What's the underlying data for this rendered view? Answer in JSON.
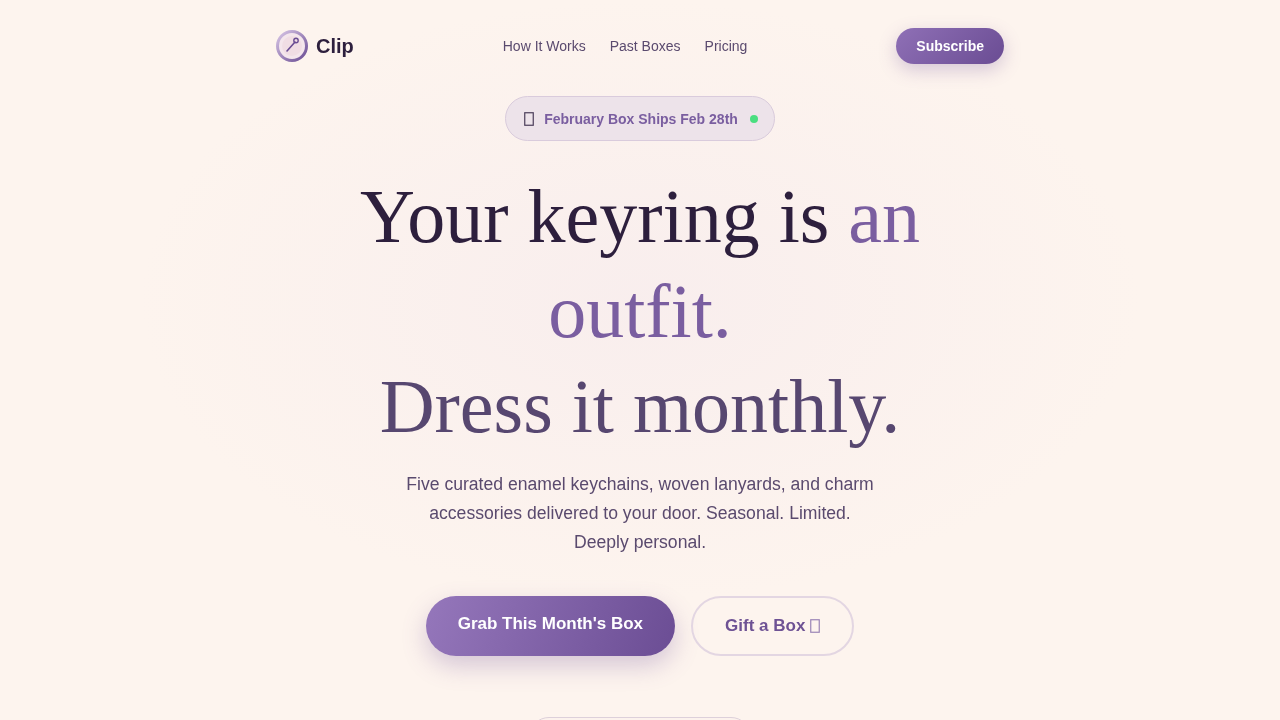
{
  "nav": {
    "brand": "Clip",
    "links": [
      "How It Works",
      "Past Boxes",
      "Pricing"
    ],
    "cta": "Subscribe"
  },
  "announcement": {
    "text": "February Box Ships Feb 28th"
  },
  "headline": {
    "lead": "Your keyring is",
    "accent": "an outfit.",
    "second_line": "Dress it monthly."
  },
  "description": "Five curated enamel keychains, woven lanyards, and charm accessories delivered to your door. Seasonal. Limited. Deeply personal.",
  "actions": [
    {
      "label": "Grab This Month's Box",
      "kind": "primary"
    },
    {
      "label": "Gift a Box",
      "kind": "secondary"
    }
  ]
}
